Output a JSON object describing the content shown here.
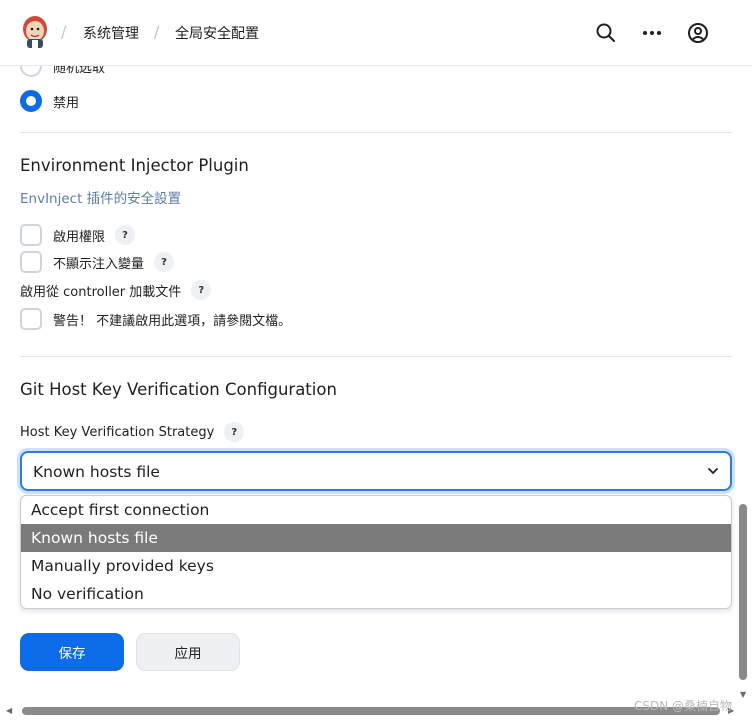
{
  "header": {
    "breadcrumb": [
      "系统管理",
      "全局安全配置"
    ],
    "icons": [
      "search-icon",
      "more-icon",
      "user-icon"
    ]
  },
  "radio_group": {
    "options": [
      {
        "label": "随机选取",
        "checked": false
      },
      {
        "label": "禁用",
        "checked": true
      }
    ]
  },
  "env_injector": {
    "title": "Environment Injector Plugin",
    "subtitle": "EnvInject 插件的安全設置",
    "enable_permissions": {
      "label": "啟用權限",
      "checked": false
    },
    "hide_injected_vars": {
      "label": "不顯示注入變量",
      "checked": false
    },
    "load_from_controller": {
      "label": "啟用從 controller 加載文件"
    },
    "warning": {
      "label": "警告！ 不建議啟用此選項，請參閱文檔。",
      "checked": false
    },
    "help_symbol": "?"
  },
  "git_host_key": {
    "title": "Git Host Key Verification Configuration",
    "strategy_label": "Host Key Verification Strategy",
    "selected": "Known hosts file",
    "options": [
      "Accept first connection",
      "Known hosts file",
      "Manually provided keys",
      "No verification"
    ],
    "selected_index": 1
  },
  "actions": {
    "save": "保存",
    "apply": "应用"
  },
  "watermark": "CSDN @桑楠自物",
  "colors": {
    "accent": "#0b6be8",
    "selected_option_bg": "#7a7a7a",
    "subtitle": "#5d7daa"
  }
}
